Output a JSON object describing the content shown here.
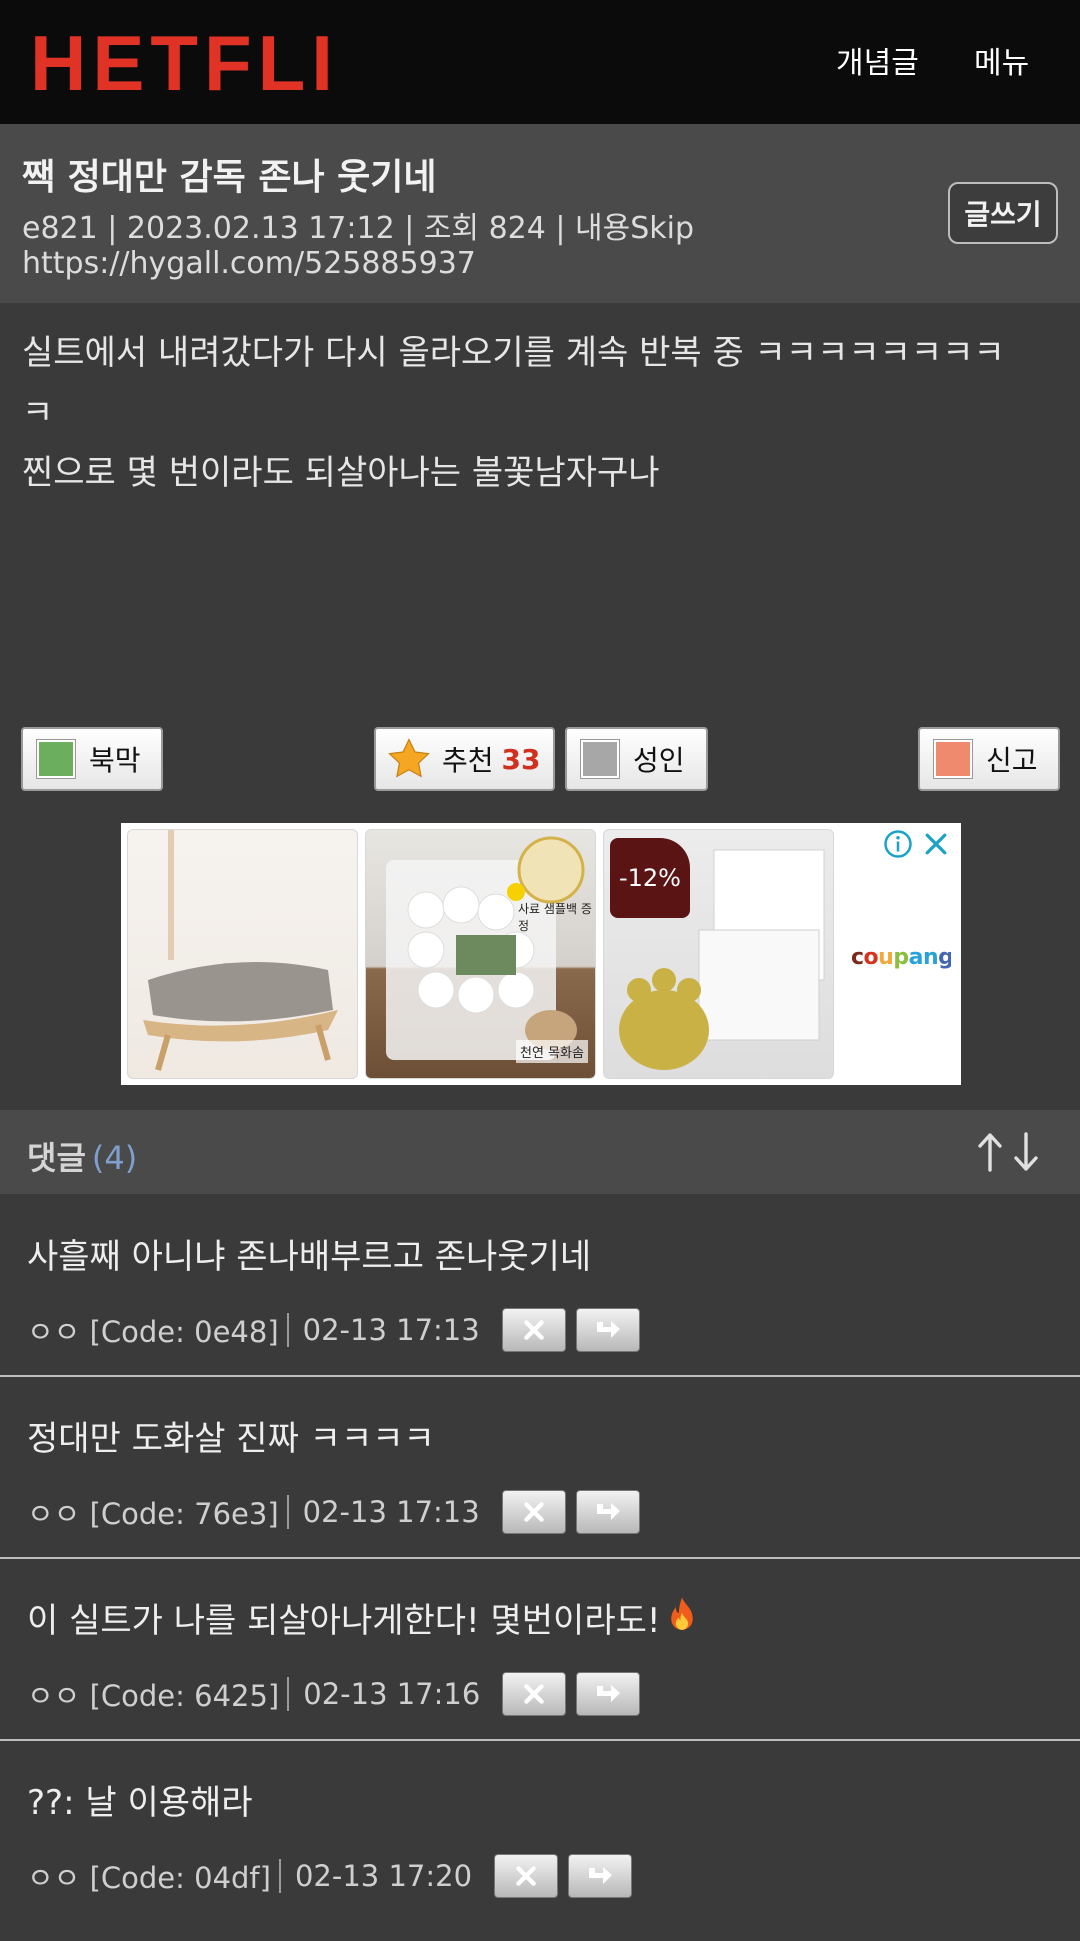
{
  "header": {
    "logo_text": "HETFLIX",
    "nav": [
      "개념글",
      "메뉴"
    ]
  },
  "post": {
    "title": "짹 정대만 감독 존나 웃기네",
    "meta": "e821 | 2023.02.13 17:12 | 조회 824 | 내용Skip",
    "url": "https://hygall.com/525885937",
    "write_label": "글쓰기",
    "body_lines": [
      "실트에서 내려갔다가 다시 올라오기를 계속 반복 중 ㅋㅋㅋㅋㅋㅋㅋㅋ",
      "ㅋ",
      "찐으로 몇 번이라도 되살아나는 불꽃남자구나"
    ]
  },
  "actions": {
    "bookmark": "북막",
    "recommend": "추천",
    "recommend_count": "33",
    "adult": "성인",
    "report": "신고",
    "colors": {
      "bookmark": "#6aae5e",
      "adult": "#a7a7a7",
      "report": "#f08a6e",
      "star": "#f5a623"
    }
  },
  "ad": {
    "discount": "-12%",
    "brand": "coupang",
    "label_sample": "사료 샘플백 증정",
    "label_cotton": "천연 목화솜"
  },
  "comments_section": {
    "title": "댓글",
    "count": "(4)"
  },
  "comments": [
    {
      "text": "사흘째 아니냐 존나배부르고 존나웃기네",
      "author": "ㅇㅇ [Code: 0e48]",
      "time": "02-13 17:13"
    },
    {
      "text": "정대만 도화살 진짜 ㅋㅋㅋㅋ",
      "author": "ㅇㅇ [Code: 76e3]",
      "time": "02-13 17:13"
    },
    {
      "text": "이 실트가 나를 되살아나게한다! 몇번이라도!",
      "author": "ㅇㅇ [Code: 6425]",
      "time": "02-13 17:16"
    },
    {
      "text": "??: 날 이용해라",
      "author": "ㅇㅇ [Code: 04df]",
      "time": "02-13 17:20"
    }
  ]
}
